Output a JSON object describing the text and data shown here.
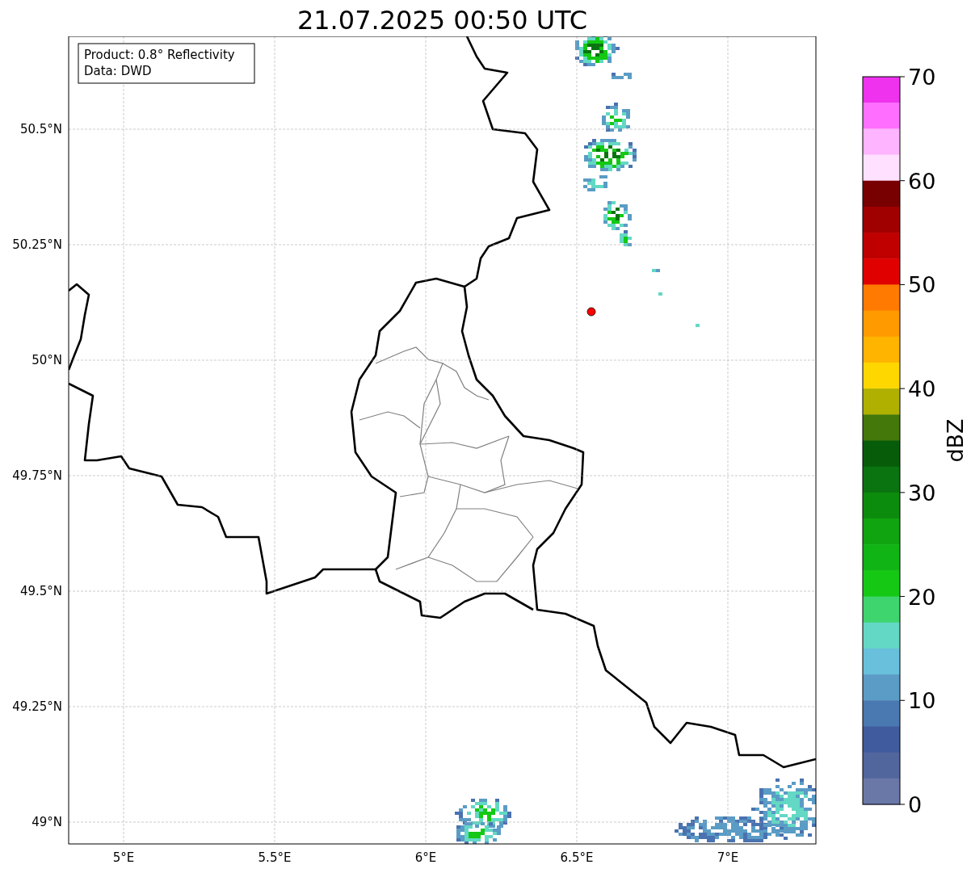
{
  "title": "21.07.2025 00:50 UTC",
  "info_box": [
    "Product: 0.8° Reflectivity",
    "Data: DWD"
  ],
  "y_tick_labels": [
    "50.5°N",
    "50.25°N",
    "50°N",
    "49.75°N",
    "49.5°N",
    "49.25°N",
    "49°N"
  ],
  "x_tick_labels": [
    "5°E",
    "5.5°E",
    "6°E",
    "6.5°E",
    "7°E"
  ],
  "colorbar": {
    "label": "dBZ",
    "tick_labels": [
      "70",
      "60",
      "50",
      "40",
      "30",
      "20",
      "10",
      "0"
    ],
    "bands": [
      {
        "color": "#ee32ee"
      },
      {
        "color": "#ff6eff"
      },
      {
        "color": "#ffb4ff"
      },
      {
        "color": "#ffe0ff"
      },
      {
        "color": "#780000"
      },
      {
        "color": "#a00000"
      },
      {
        "color": "#c00000"
      },
      {
        "color": "#e00000"
      },
      {
        "color": "#ff7a00"
      },
      {
        "color": "#ff9a00"
      },
      {
        "color": "#ffb400"
      },
      {
        "color": "#ffd700"
      },
      {
        "color": "#b0b000"
      },
      {
        "color": "#44780a"
      },
      {
        "color": "#075c0a"
      },
      {
        "color": "#0a7410"
      },
      {
        "color": "#0c8c0c"
      },
      {
        "color": "#10a410"
      },
      {
        "color": "#10b414"
      },
      {
        "color": "#14c814"
      },
      {
        "color": "#3ed46e"
      },
      {
        "color": "#63d8c4"
      },
      {
        "color": "#68c0dc"
      },
      {
        "color": "#5a9cc5"
      },
      {
        "color": "#4a78b0"
      },
      {
        "color": "#415c9e"
      },
      {
        "color": "#52669e"
      },
      {
        "color": "#6a78a8"
      }
    ]
  }
}
